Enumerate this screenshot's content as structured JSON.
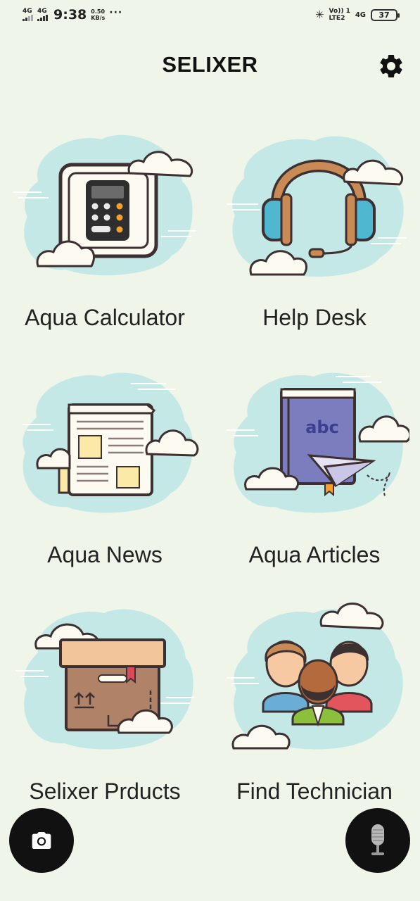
{
  "status_bar": {
    "sim1_network": "4G",
    "sim2_network": "4G",
    "time": "9:38",
    "speed_value": "0.50",
    "speed_unit": "KB/s",
    "more": "···",
    "volte_top": "Vo)) 1",
    "volte_bottom": "LTE2",
    "network_type": "4G",
    "battery_level": "37"
  },
  "app_bar": {
    "title": "SELIXER",
    "settings_icon": "gear-icon"
  },
  "tiles": [
    {
      "label": "Aqua Calculator",
      "icon": "calculator-icon"
    },
    {
      "label": "Help Desk",
      "icon": "headphones-icon"
    },
    {
      "label": "Aqua News",
      "icon": "newspaper-icon"
    },
    {
      "label": "Aqua Articles",
      "icon": "book-icon",
      "book_text": "abc"
    },
    {
      "label": "Selixer Prducts",
      "icon": "package-box-icon"
    },
    {
      "label": "Find Technician",
      "icon": "people-icon"
    }
  ],
  "fabs": {
    "camera_icon": "camera-icon",
    "mic_icon": "microphone-icon"
  },
  "colors": {
    "background": "#eff6e9",
    "cloud_blob": "#c4e8e6",
    "fab": "#111111"
  }
}
